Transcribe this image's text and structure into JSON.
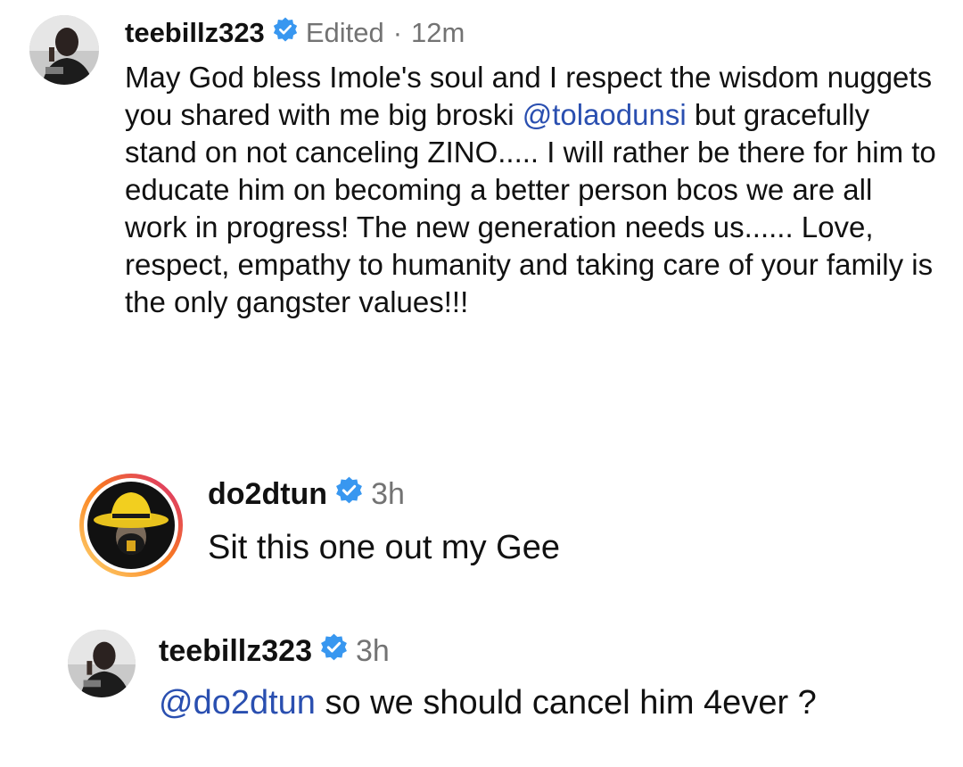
{
  "comments": [
    {
      "username": "teebillz323",
      "edited_label": "Edited",
      "separator": "·",
      "time": "12m",
      "avatar_icon": "profile-photo-man",
      "text_before_mention": "May God bless Imole's soul and I respect the wisdom nuggets you shared with me big broski ",
      "mention": "@tolaodunsi",
      "text_after_mention": " but gracefully stand on not canceling ZINO..... I will rather be there for him to educate him on becoming a better person bcos we are all work in progress! The new generation needs us...... Love, respect, empathy to humanity and taking care of your family is the only gangster values!!!"
    },
    {
      "username": "do2dtun",
      "time": "3h",
      "avatar_icon": "story-ring-avatar-yellow-hat",
      "text": "Sit this one out my Gee"
    },
    {
      "username": "teebillz323",
      "time": "3h",
      "avatar_icon": "profile-photo-man",
      "mention": "@do2dtun",
      "text_after_mention": " so we should cancel him 4ever ?"
    }
  ],
  "colors": {
    "verified_blue": "#3897f0",
    "mention_blue": "#2a4fb0",
    "meta_gray": "#737373",
    "story_ring_start": "#feda75",
    "story_ring_mid": "#fa7e1e",
    "story_ring_end": "#d62976"
  }
}
